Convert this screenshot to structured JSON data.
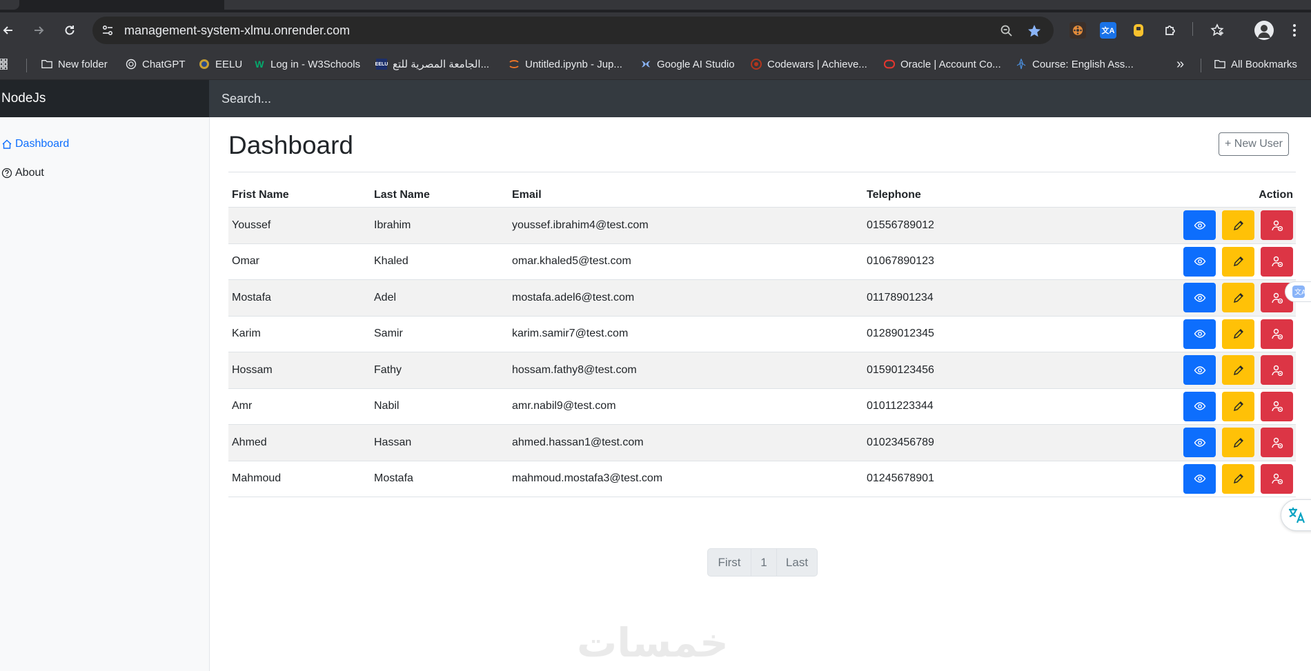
{
  "browser": {
    "url": "management-system-xlmu.onrender.com",
    "bookmarks": [
      {
        "label": "New folder",
        "icon": "folder-icon"
      },
      {
        "label": "ChatGPT",
        "icon": "chatgpt-icon"
      },
      {
        "label": "EELU",
        "icon": "eelu-icon"
      },
      {
        "label": "Log in - W3Schools",
        "icon": "w3schools-icon"
      },
      {
        "label": "...الجامعة المصرية للتع",
        "icon": "university-icon"
      },
      {
        "label": "Untitled.ipynb - Jup...",
        "icon": "jupyter-icon"
      },
      {
        "label": "Google AI Studio",
        "icon": "ai-studio-icon"
      },
      {
        "label": "Codewars | Achieve...",
        "icon": "codewars-icon"
      },
      {
        "label": "Oracle | Account Co...",
        "icon": "oracle-icon"
      },
      {
        "label": "Course: English Ass...",
        "icon": "course-icon"
      }
    ],
    "all_bookmarks": "All Bookmarks",
    "more": "»"
  },
  "app": {
    "brand": "NodeJs",
    "search_placeholder": "Search...",
    "sidebar": [
      {
        "label": "Dashboard",
        "icon": "home-icon",
        "active": true
      },
      {
        "label": "About",
        "icon": "question-circle-icon",
        "active": false
      }
    ],
    "page_title": "Dashboard",
    "new_user": "+ New User",
    "columns": [
      "Frist Name",
      "Last Name",
      "Email",
      "Telephone",
      "Action"
    ],
    "rows": [
      {
        "first": "Youssef",
        "last": "Ibrahim",
        "email": "youssef.ibrahim4@test.com",
        "phone": "01556789012"
      },
      {
        "first": "Omar",
        "last": "Khaled",
        "email": "omar.khaled5@test.com",
        "phone": "01067890123"
      },
      {
        "first": "Mostafa",
        "last": "Adel",
        "email": "mostafa.adel6@test.com",
        "phone": "01178901234"
      },
      {
        "first": "Karim",
        "last": "Samir",
        "email": "karim.samir7@test.com",
        "phone": "01289012345"
      },
      {
        "first": "Hossam",
        "last": "Fathy",
        "email": "hossam.fathy8@test.com",
        "phone": "01590123456"
      },
      {
        "first": "Amr",
        "last": "Nabil",
        "email": "amr.nabil9@test.com",
        "phone": "01011223344"
      },
      {
        "first": "Ahmed",
        "last": "Hassan",
        "email": "ahmed.hassan1@test.com",
        "phone": "01023456789"
      },
      {
        "first": "Mahmoud",
        "last": "Mostafa",
        "email": "mahmoud.mostafa3@test.com",
        "phone": "01245678901"
      }
    ],
    "row_actions": {
      "view": "eye-icon",
      "edit": "pencil-icon",
      "delete": "user-remove-icon"
    },
    "pagination": [
      "First",
      "1",
      "Last"
    ],
    "watermark": "خمسات"
  },
  "colors": {
    "primary": "#0d6efd",
    "warning": "#ffc107",
    "danger": "#dc3545",
    "header_dark": "#212529",
    "header": "#343a40"
  }
}
